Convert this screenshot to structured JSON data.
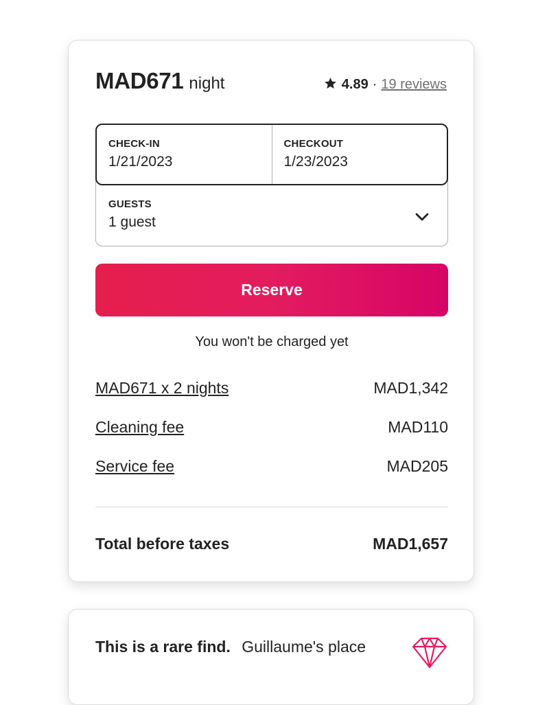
{
  "booking": {
    "price": "MAD671",
    "price_unit": "night",
    "rating": "4.89",
    "rating_separator": "·",
    "reviews_link": "19 reviews",
    "checkin_label": "CHECK-IN",
    "checkin_value": "1/21/2023",
    "checkout_label": "CHECKOUT",
    "checkout_value": "1/23/2023",
    "guests_label": "GUESTS",
    "guests_value": "1 guest",
    "reserve_label": "Reserve",
    "charge_note": "You won't be charged yet",
    "fees": [
      {
        "label": "MAD671 x 2 nights",
        "amount": "MAD1,342"
      },
      {
        "label": "Cleaning fee",
        "amount": "MAD110"
      },
      {
        "label": "Service fee",
        "amount": "MAD205"
      }
    ],
    "total_label": "Total before taxes",
    "total_amount": "MAD1,657"
  },
  "rare_find": {
    "headline": "This is a rare find.",
    "text": "Guillaume's place"
  },
  "icons": {
    "rating": "star-icon",
    "guests_dropdown": "chevron-down-icon",
    "rare_find": "diamond-icon"
  },
  "colors": {
    "reserve_gradient_start": "#e61e4d",
    "reserve_gradient_end": "#d70466",
    "diamond": "#e31c5f",
    "text": "#222222",
    "muted": "#717171"
  }
}
